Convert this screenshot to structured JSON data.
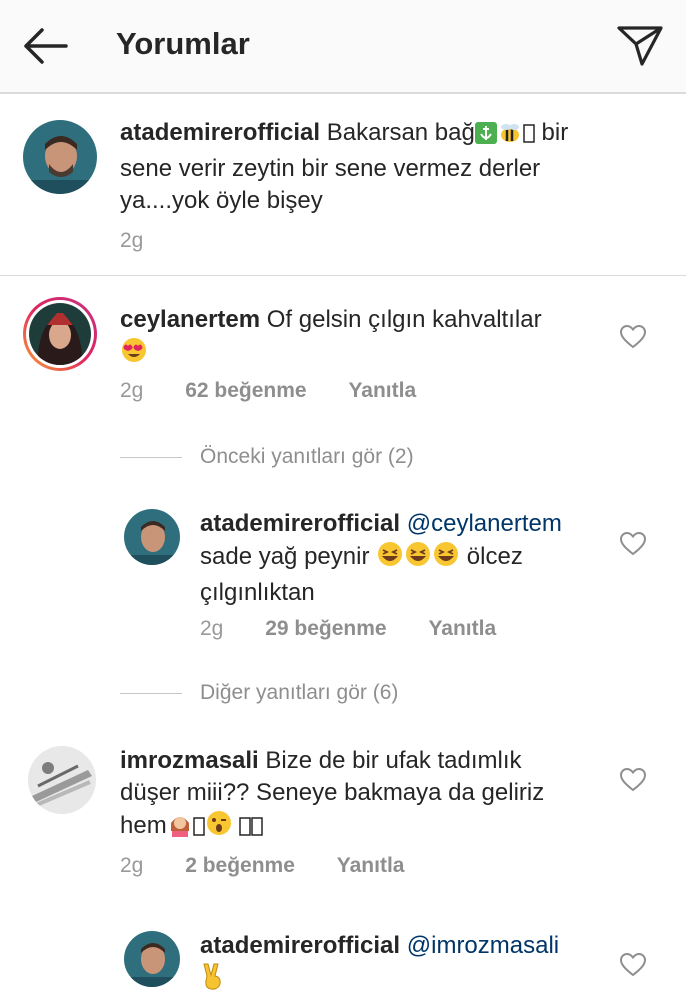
{
  "header": {
    "title": "Yorumlar",
    "back_icon": "arrow-left-icon",
    "send_icon": "paper-plane-icon"
  },
  "caption": {
    "username": "atademirerofficial",
    "text_1": "Bakarsan bağ",
    "text_2": "bir",
    "text_3": "sene verir zeytin bir sene vermez derler",
    "text_4": "ya....yok öyle bişey",
    "time": "2g"
  },
  "comments": [
    {
      "username": "ceylanertem",
      "text_1": "Of gelsin çılgın kahvaltılar",
      "time": "2g",
      "likes": "62 beğenme",
      "reply": "Yanıtla"
    },
    {
      "username": "imrozmasali",
      "text_1": "Bize de bir ufak tadımlık",
      "text_2": "düşer miii?? Seneye bakmaya da geliriz",
      "text_3": "hem",
      "time": "2g",
      "likes": "2 beğenme",
      "reply": "Yanıtla"
    }
  ],
  "replies": [
    {
      "username": "atademirerofficial",
      "mention": "@ceylanertem",
      "text_1": "sade yağ peynir",
      "text_2": "ölcez",
      "text_3": "çılgınlıktan",
      "time": "2g",
      "likes": "29 beğenme",
      "reply": "Yanıtla"
    },
    {
      "username": "atademirerofficial",
      "mention": "@imrozmasali"
    }
  ],
  "toggles": {
    "previous": "Önceki yanıtları gör (2)",
    "more": "Diğer yanıtları gör (6)"
  },
  "colors": {
    "mention": "#003569",
    "muted": "#999999",
    "story_ring": "#e0245e"
  }
}
